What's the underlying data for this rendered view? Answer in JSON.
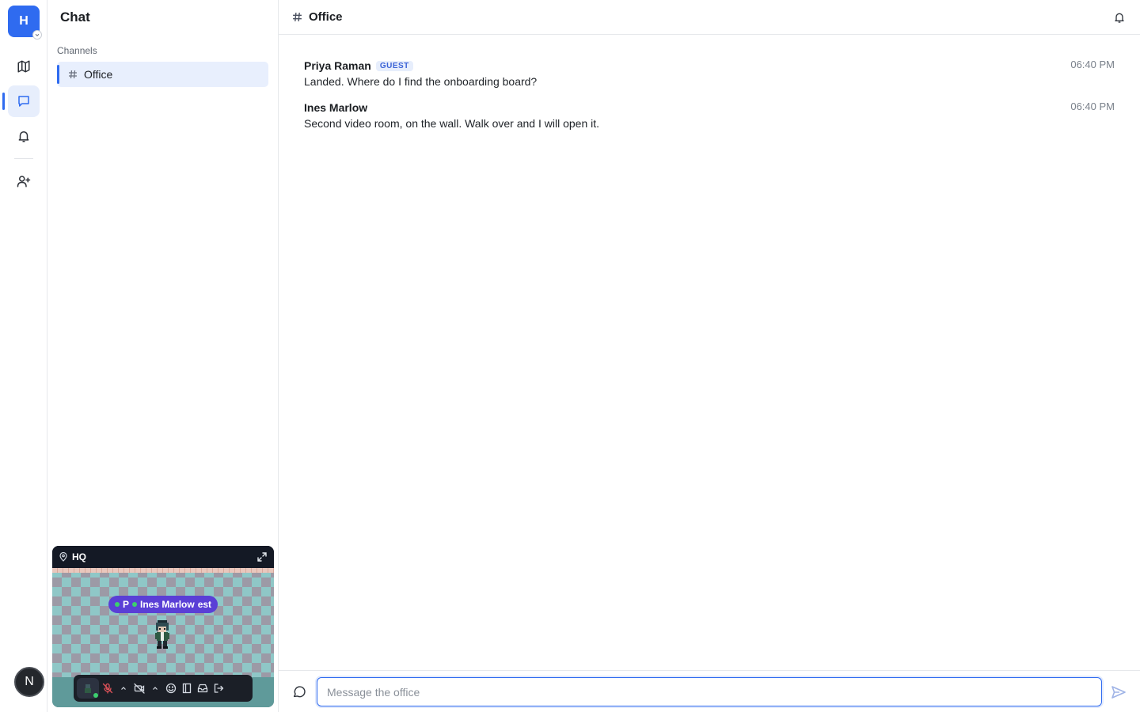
{
  "workspace": {
    "initial": "H"
  },
  "rail": {
    "items": [
      {
        "icon": "map-icon"
      },
      {
        "icon": "chat-icon",
        "active": true
      },
      {
        "icon": "bell-icon"
      },
      {
        "icon": "add-user-icon"
      }
    ]
  },
  "user": {
    "initial": "N"
  },
  "sidebar": {
    "title": "Chat",
    "section_label": "Channels",
    "channels": [
      {
        "label": "Office",
        "active": true
      }
    ]
  },
  "minimap": {
    "name": "HQ",
    "name_tag": {
      "left": "P",
      "center": "Ines Marlow",
      "right": "est"
    },
    "toolbar": [
      "avatar",
      "mic-off-icon",
      "chevron-up-icon",
      "camera-off-icon",
      "chevron-up-icon",
      "emoji-icon",
      "door-icon",
      "inbox-icon",
      "leave-icon"
    ]
  },
  "main": {
    "channel_title": "Office",
    "messages": [
      {
        "author": "Priya Raman",
        "badge": "GUEST",
        "time": "06:40 PM",
        "text": "Landed. Where do I find the onboarding board?"
      },
      {
        "author": "Ines Marlow",
        "badge": "",
        "time": "06:40 PM",
        "text": "Second video room, on the wall. Walk over and I will open it."
      }
    ],
    "composer": {
      "placeholder": "Message the office",
      "value": ""
    }
  },
  "colors": {
    "accent": "#2f6bf0",
    "guest_badge": "#3b63d6",
    "name_tag": "#5a3fd6",
    "online": "#3ccf6e"
  }
}
